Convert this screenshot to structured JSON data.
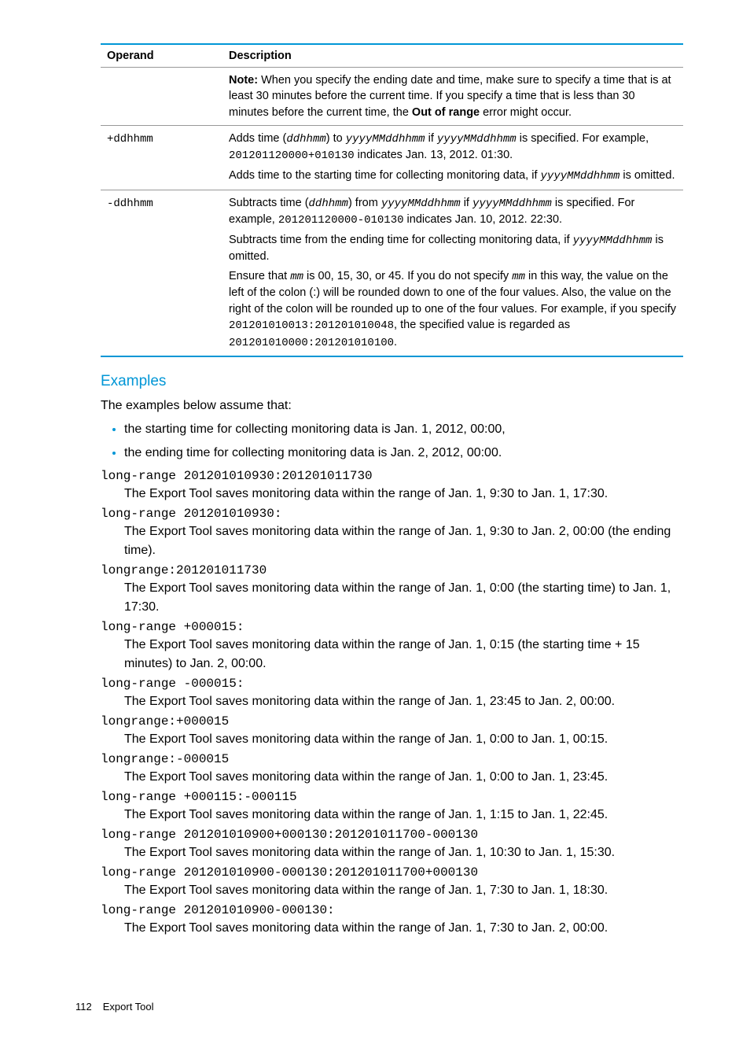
{
  "table": {
    "headers": {
      "operand": "Operand",
      "description": "Description"
    },
    "rows": [
      {
        "operand": "",
        "paras": [
          {
            "segs": [
              {
                "t": "b",
                "v": "Note:"
              },
              {
                "t": "n",
                "v": " When you specify the ending date and time, make sure to specify a time that is at least 30 minutes before the current time. If you specify a time that is less than 30 minutes before the current time, the "
              },
              {
                "t": "b",
                "v": "Out of range"
              },
              {
                "t": "n",
                "v": " error might occur."
              }
            ]
          }
        ]
      },
      {
        "operand": "+ddhhmm",
        "operand_style": "mono",
        "paras": [
          {
            "segs": [
              {
                "t": "n",
                "v": "Adds time ("
              },
              {
                "t": "mi",
                "v": "ddhhmm"
              },
              {
                "t": "n",
                "v": ") to "
              },
              {
                "t": "mi",
                "v": "yyyyMMddhhmm"
              },
              {
                "t": "n",
                "v": " if "
              },
              {
                "t": "mi",
                "v": "yyyyMMddhhmm"
              },
              {
                "t": "n",
                "v": " is specified. For example, "
              },
              {
                "t": "m",
                "v": "201201120000+010130"
              },
              {
                "t": "n",
                "v": " indicates Jan. 13, 2012. 01:30."
              }
            ]
          },
          {
            "segs": [
              {
                "t": "n",
                "v": "Adds time to the starting time for collecting monitoring data, if "
              },
              {
                "t": "mi",
                "v": "yyyyMMddhhmm"
              },
              {
                "t": "n",
                "v": " is omitted."
              }
            ]
          }
        ]
      },
      {
        "operand": "-ddhhmm",
        "operand_style": "mono",
        "paras": [
          {
            "segs": [
              {
                "t": "n",
                "v": "Subtracts time ("
              },
              {
                "t": "mi",
                "v": "ddhhmm"
              },
              {
                "t": "n",
                "v": ") from "
              },
              {
                "t": "mi",
                "v": "yyyyMMddhhmm"
              },
              {
                "t": "n",
                "v": " if "
              },
              {
                "t": "mi",
                "v": "yyyyMMddhhmm"
              },
              {
                "t": "n",
                "v": " is specified. For example, "
              },
              {
                "t": "m",
                "v": "201201120000-010130"
              },
              {
                "t": "n",
                "v": " indicates Jan. 10, 2012. 22:30."
              }
            ]
          },
          {
            "segs": [
              {
                "t": "n",
                "v": "Subtracts time from the ending time for collecting monitoring data, if "
              },
              {
                "t": "mi",
                "v": "yyyyMMddhhmm"
              },
              {
                "t": "n",
                "v": " is omitted."
              }
            ]
          },
          {
            "segs": [
              {
                "t": "n",
                "v": "Ensure that "
              },
              {
                "t": "mi",
                "v": "mm"
              },
              {
                "t": "n",
                "v": " is 00, 15, 30, or 45. If you do not specify "
              },
              {
                "t": "mi",
                "v": "mm"
              },
              {
                "t": "n",
                "v": " in this way, the value on the left of the colon (:) will be rounded down to one of the four values. Also, the value on the right of the colon will be rounded up to one of the four values. For example, if you specify "
              },
              {
                "t": "m",
                "v": "201201010013:201201010048"
              },
              {
                "t": "n",
                "v": ", the specified value is regarded as "
              },
              {
                "t": "m",
                "v": "201201010000:201201010100"
              },
              {
                "t": "n",
                "v": "."
              }
            ]
          }
        ]
      }
    ]
  },
  "examples": {
    "heading": "Examples",
    "intro": "The examples below assume that:",
    "bullets": [
      "the starting time for collecting monitoring data is Jan. 1, 2012, 00:00,",
      "the ending time for collecting monitoring data is Jan. 2, 2012, 00:00."
    ],
    "items": [
      {
        "cmd": "long-range 201201010930:201201011730",
        "desc": "The Export Tool saves monitoring data within the range of Jan. 1, 9:30 to Jan. 1, 17:30."
      },
      {
        "cmd": "long-range 201201010930:",
        "desc": "The Export Tool saves monitoring data within the range of Jan. 1, 9:30 to Jan. 2, 00:00 (the ending time)."
      },
      {
        "cmd": "longrange:201201011730",
        "desc": "The Export Tool saves monitoring data within the range of Jan. 1, 0:00 (the starting time) to Jan. 1, 17:30."
      },
      {
        "cmd": "long-range +000015:",
        "desc": "The Export Tool saves monitoring data within the range of Jan. 1, 0:15 (the starting time + 15 minutes) to Jan. 2, 00:00."
      },
      {
        "cmd": "long-range -000015:",
        "desc": "The Export Tool saves monitoring data within the range of Jan. 1, 23:45 to Jan. 2, 00:00."
      },
      {
        "cmd": "longrange:+000015",
        "desc": "The Export Tool saves monitoring data within the range of Jan. 1, 0:00 to Jan. 1, 00:15."
      },
      {
        "cmd": "longrange:-000015",
        "desc": "The Export Tool saves monitoring data within the range of Jan. 1, 0:00 to Jan. 1, 23:45."
      },
      {
        "cmd": "long-range +000115:-000115",
        "desc": "The Export Tool saves monitoring data within the range of Jan. 1, 1:15 to Jan. 1, 22:45."
      },
      {
        "cmd": "long-range 201201010900+000130:201201011700-000130",
        "desc": "The Export Tool saves monitoring data within the range of Jan. 1, 10:30 to Jan. 1, 15:30."
      },
      {
        "cmd": "long-range 201201010900-000130:201201011700+000130",
        "desc": "The Export Tool saves monitoring data within the range of Jan. 1, 7:30 to Jan. 1, 18:30."
      },
      {
        "cmd": "long-range 201201010900-000130:",
        "desc": "The Export Tool saves monitoring data within the range of Jan. 1, 7:30 to Jan. 2, 00:00."
      }
    ]
  },
  "footer": {
    "page": "112",
    "section": "Export Tool"
  }
}
